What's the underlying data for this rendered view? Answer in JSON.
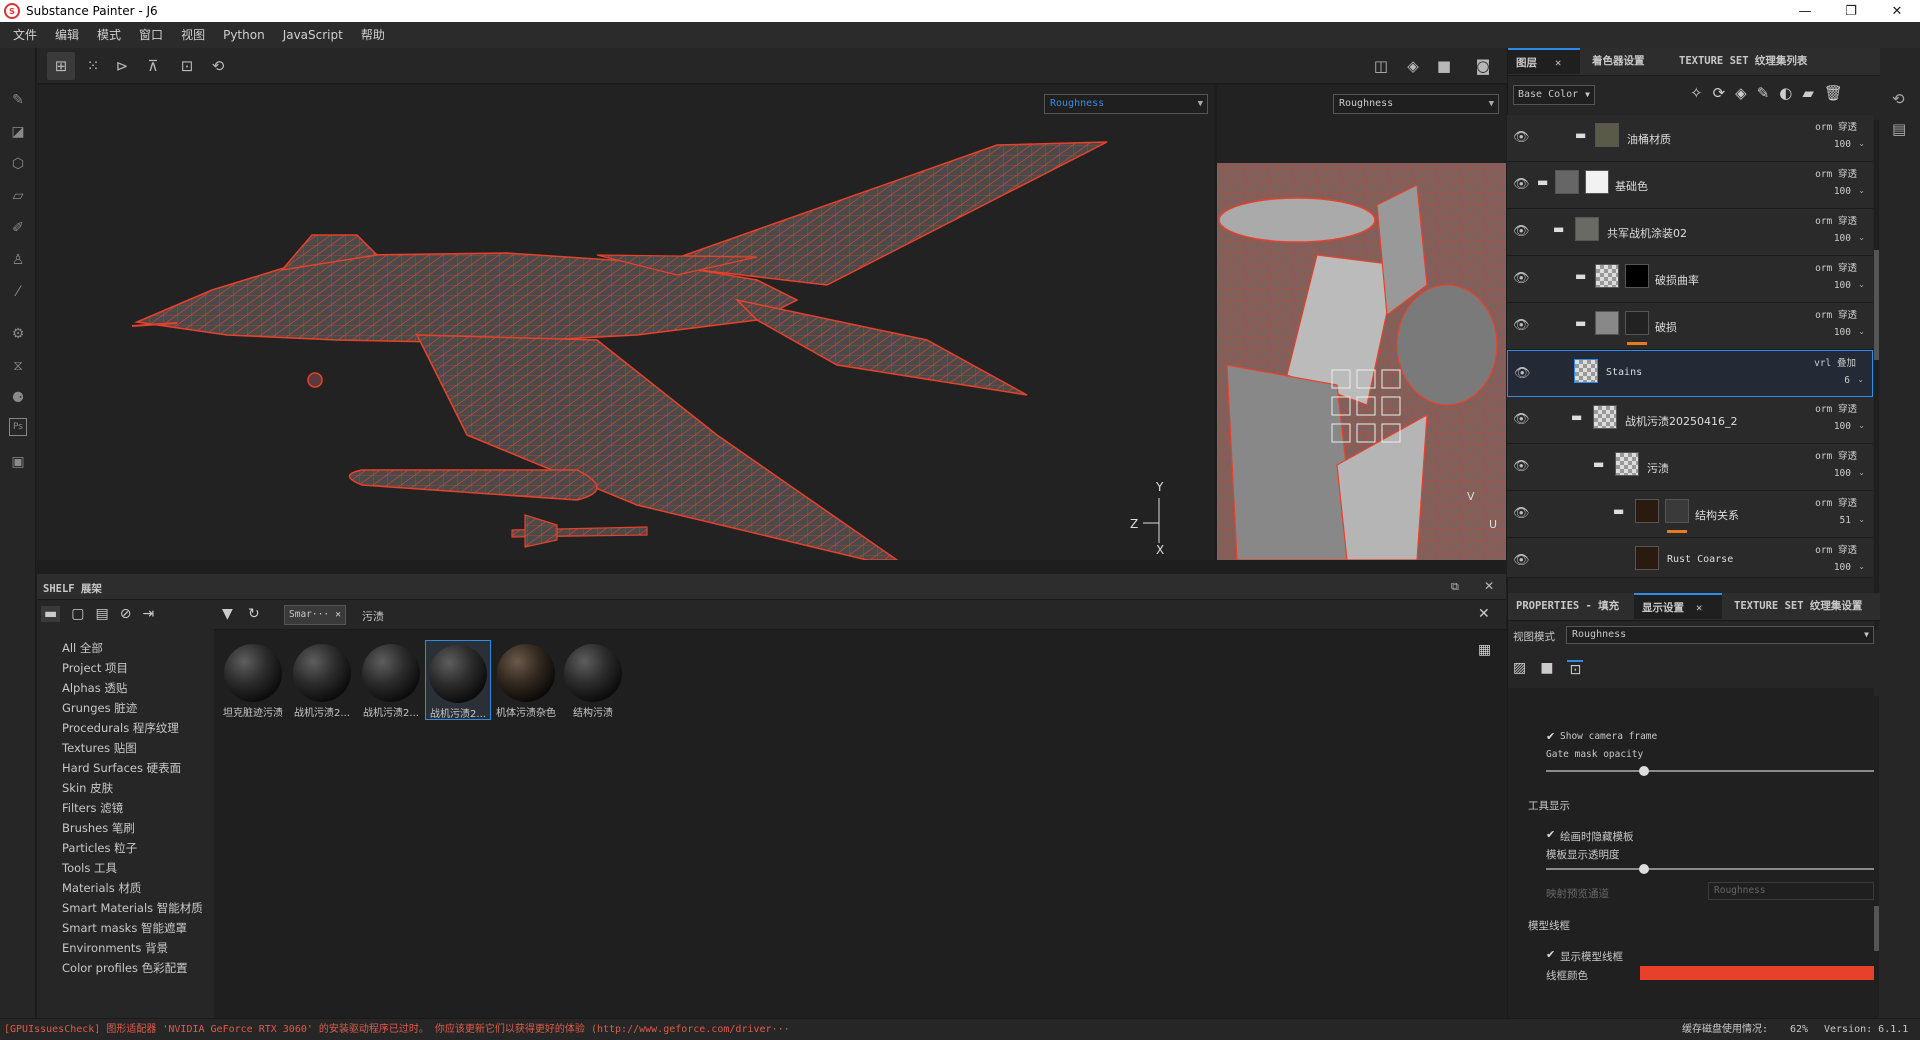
{
  "window": {
    "title": "Substance Painter - J6",
    "minimize": "—",
    "maximize": "❐",
    "close": "✕"
  },
  "menu": [
    "文件",
    "编辑",
    "模式",
    "窗口",
    "视图",
    "Python",
    "JavaScript",
    "帮助"
  ],
  "viewport": {
    "left_channel": "Roughness",
    "right_channel": "Roughness",
    "axis_y": "Y",
    "axis_z": "Z",
    "axis_x": "X",
    "uv_v": "V",
    "uv_u": "U"
  },
  "shelf": {
    "title": "SHELF 展架",
    "search_tag": "Smar···",
    "search_text": "污渍",
    "categories": [
      "All 全部",
      "Project 项目",
      "Alphas 透贴",
      "Grunges 脏迹",
      "Procedurals 程序纹理",
      "Textures 贴图",
      "Hard Surfaces 硬表面",
      "Skin 皮肤",
      "Filters 滤镜",
      "Brushes 笔刷",
      "Particles 粒子",
      "Tools 工具",
      "Materials 材质",
      "Smart Materials 智能材质",
      "Smart masks 智能遮罩",
      "Environments 背景",
      "Color profiles 色彩配置"
    ],
    "items": [
      "坦克脏迹污渍",
      "战机污渍2...",
      "战机污渍2...",
      "战机污渍2...",
      "机体污渍杂色",
      "结构污渍"
    ]
  },
  "layers_panel": {
    "tabs": [
      "图层",
      "着色器设置",
      "TEXTURE SET 纹理集列表"
    ],
    "channel": "Base Color",
    "layers": [
      {
        "name": "油桶材质",
        "blend": "orm 穿透",
        "opacity": "100"
      },
      {
        "name": "基础色",
        "blend": "orm 穿透",
        "opacity": "100"
      },
      {
        "name": "共军战机涂装02",
        "blend": "orm 穿透",
        "opacity": "100"
      },
      {
        "name": "破损曲率",
        "blend": "orm 穿透",
        "opacity": "100"
      },
      {
        "name": "破损",
        "blend": "orm 穿透",
        "opacity": "100"
      },
      {
        "name": "Stains",
        "blend": "vrl 叠加",
        "opacity": "6"
      },
      {
        "name": "战机污渍20250416_2",
        "blend": "orm 穿透",
        "opacity": "100"
      },
      {
        "name": "污渍",
        "blend": "orm 穿透",
        "opacity": "100"
      },
      {
        "name": "结构关系",
        "blend": "orm 穿透",
        "opacity": "51"
      },
      {
        "name": "Rust Coarse",
        "blend": "orm 穿透",
        "opacity": "100"
      }
    ]
  },
  "properties_panel": {
    "tabs": [
      "PROPERTIES - 填充",
      "显示设置",
      "TEXTURE SET 纹理集设置"
    ],
    "view_mode_label": "视图模式",
    "view_mode_value": "Roughness",
    "show_camera_frame": "Show camera frame",
    "gate_mask_opacity": "Gate mask opacity",
    "gate_mask_opacity_value": 0.3,
    "tool_display": "工具显示",
    "hide_stencil": "绘画时隐藏模板",
    "stencil_opacity": "模板显示透明度",
    "stencil_opacity_value": 0.3,
    "projection_channel": "映射预览通道",
    "projection_channel_value": "Roughness",
    "wireframe": "模型线框",
    "show_wireframe": "显示模型线框",
    "wireframe_color": "线框颜色",
    "wireframe_color_hex": "#e8412b"
  },
  "status": {
    "warning": "[GPUIssuesCheck] 图形适配器 'NVIDIA GeForce RTX 3060' 的安装驱动程序已过时。 你应该更新它们以获得更好的体验 (http://www.geforce.com/driver···",
    "cache_label": "缓存磁盘使用情况:",
    "cache_value": "62%",
    "version": "Version: 6.1.1"
  },
  "colors": {
    "accent": "#2d8ce8",
    "warning": "#e05a4a",
    "wire": "#e8412b"
  }
}
